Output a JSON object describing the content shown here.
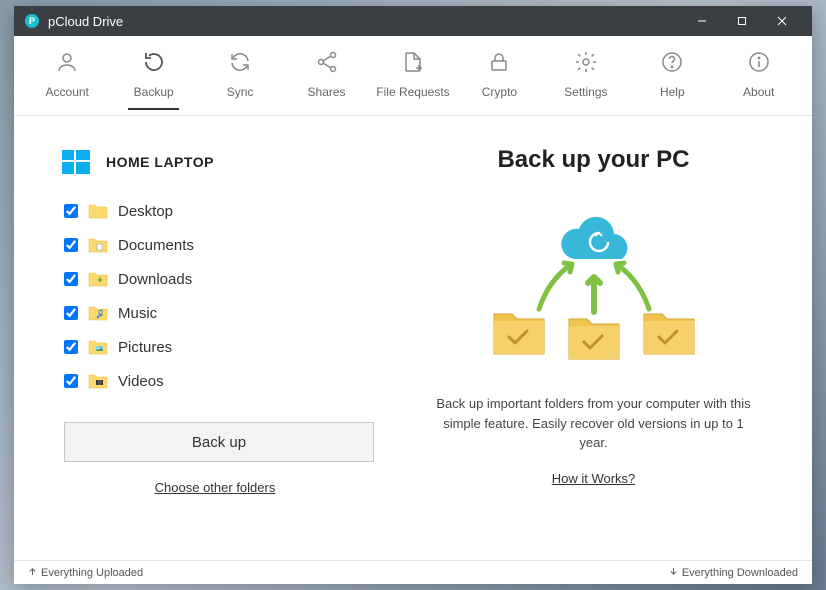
{
  "window": {
    "title": "pCloud Drive"
  },
  "toolbar": {
    "items": [
      {
        "label": "Account"
      },
      {
        "label": "Backup"
      },
      {
        "label": "Sync"
      },
      {
        "label": "Shares"
      },
      {
        "label": "File Requests"
      },
      {
        "label": "Crypto"
      },
      {
        "label": "Settings"
      },
      {
        "label": "Help"
      },
      {
        "label": "About"
      }
    ]
  },
  "device": {
    "name": "HOME LAPTOP"
  },
  "folders": [
    {
      "name": "Desktop"
    },
    {
      "name": "Documents"
    },
    {
      "name": "Downloads"
    },
    {
      "name": "Music"
    },
    {
      "name": "Pictures"
    },
    {
      "name": "Videos"
    }
  ],
  "actions": {
    "backup_label": "Back up",
    "choose_label": "Choose other folders"
  },
  "promo": {
    "title": "Back up your PC",
    "description": "Back up important folders from your computer with this simple feature. Easily recover old versions in up to 1 year.",
    "how_link": "How it Works?"
  },
  "status": {
    "uploaded": "Everything Uploaded",
    "downloaded": "Everything Downloaded"
  }
}
